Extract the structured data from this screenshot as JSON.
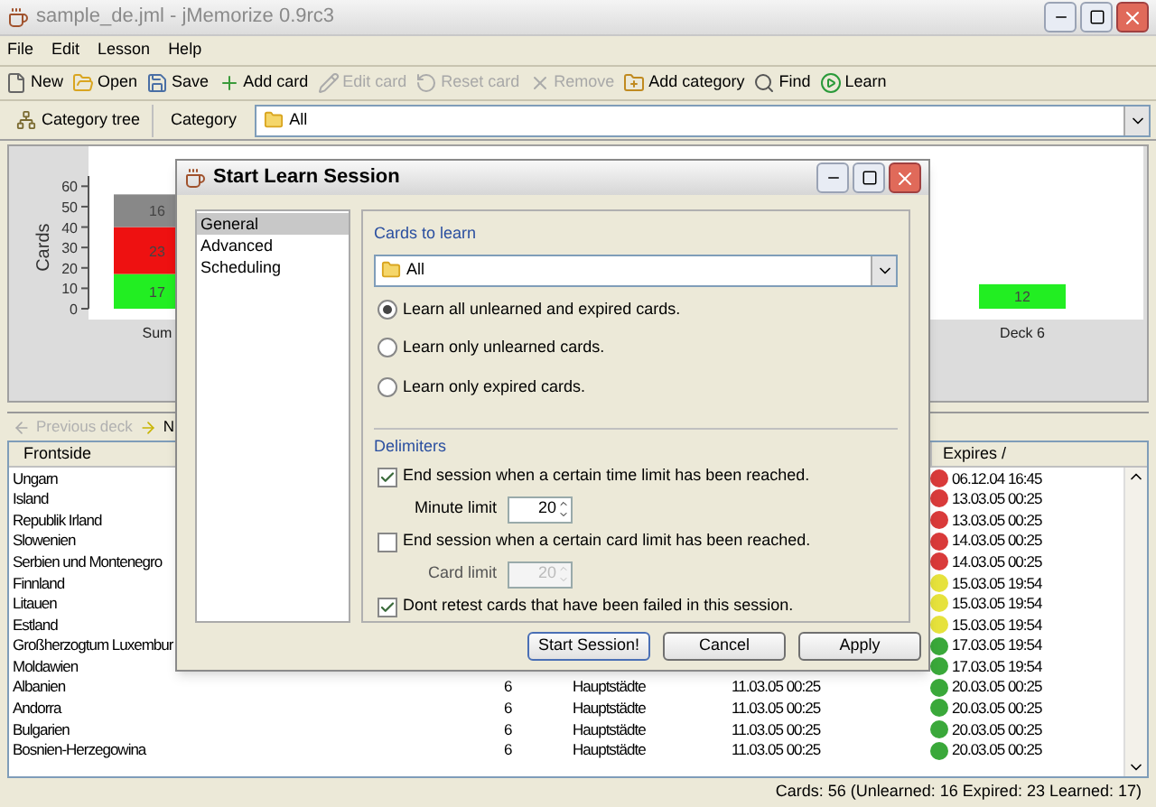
{
  "window": {
    "title": "sample_de.jml - jMemorize 0.9rc3"
  },
  "menu": [
    "File",
    "Edit",
    "Lesson",
    "Help"
  ],
  "toolbar": [
    {
      "label": "New",
      "disabled": false
    },
    {
      "label": "Open",
      "disabled": false
    },
    {
      "label": "Save",
      "disabled": false
    },
    {
      "label": "Add card",
      "disabled": false
    },
    {
      "label": "Edit card",
      "disabled": true
    },
    {
      "label": "Reset card",
      "disabled": true
    },
    {
      "label": "Remove",
      "disabled": true
    },
    {
      "label": "Add category",
      "disabled": false
    },
    {
      "label": "Find",
      "disabled": false
    },
    {
      "label": "Learn",
      "disabled": false
    }
  ],
  "category_bar": {
    "tree_button": "Category tree",
    "label": "Category",
    "value": "All"
  },
  "chart": {
    "chart_data": {
      "type": "bar",
      "ylabel": "Cards",
      "categories": [
        "Sum",
        "Deck 6"
      ],
      "stacked": true,
      "yticks": [
        0,
        10,
        20,
        30,
        40,
        50,
        60
      ],
      "ylim": [
        0,
        65
      ],
      "data_labels": true,
      "series": [
        {
          "color": "#22ee22",
          "values": [
            17,
            12
          ]
        },
        {
          "color": "#ee1111",
          "values": [
            23,
            null
          ]
        },
        {
          "color": "#888888",
          "values": [
            16,
            null
          ]
        }
      ]
    }
  },
  "deck_nav": [
    {
      "label": "Previous deck",
      "disabled": true
    },
    {
      "label": "N",
      "disabled": false
    }
  ],
  "table": {
    "columns": [
      "Frontside",
      "Expires /"
    ],
    "rows": [
      {
        "frontside": "Ungarn",
        "expires": "06.12.04 16:45",
        "color": "#d93a3a"
      },
      {
        "frontside": "Island",
        "expires": "13.03.05 00:25",
        "color": "#d93a3a"
      },
      {
        "frontside": "Republik Irland",
        "expires": "13.03.05 00:25",
        "color": "#d93a3a"
      },
      {
        "frontside": "Slowenien",
        "expires": "14.03.05 00:25",
        "color": "#d93a3a"
      },
      {
        "frontside": "Serbien und Montenegro",
        "expires": "14.03.05 00:25",
        "color": "#d93a3a"
      },
      {
        "frontside": "Finnland",
        "expires": "15.03.05 19:54",
        "color": "#e6e23c"
      },
      {
        "frontside": "Litauen",
        "expires": "15.03.05 19:54",
        "color": "#e6e23c"
      },
      {
        "frontside": "Estland",
        "expires": "15.03.05 19:54",
        "color": "#e6e23c"
      },
      {
        "frontside": "Großherzogtum Luxembur",
        "expires": "17.03.05 19:54",
        "color": "#3aa83a"
      },
      {
        "frontside": "Moldawien",
        "expires": "17.03.05 19:54",
        "color": "#3aa83a"
      },
      {
        "frontside": "Albanien",
        "deck": "6",
        "category": "Hauptstädte",
        "date": "11.03.05 00:25",
        "expires": "20.03.05 00:25",
        "color": "#3aa83a"
      },
      {
        "frontside": "Andorra",
        "deck": "6",
        "category": "Hauptstädte",
        "date": "11.03.05 00:25",
        "expires": "20.03.05 00:25",
        "color": "#3aa83a"
      },
      {
        "frontside": "Bulgarien",
        "deck": "6",
        "category": "Hauptstädte",
        "date": "11.03.05 00:25",
        "expires": "20.03.05 00:25",
        "color": "#3aa83a"
      },
      {
        "frontside": "Bosnien-Herzegowina",
        "deck": "6",
        "category": "Hauptstädte",
        "date": "11.03.05 00:25",
        "expires": "20.03.05 00:25",
        "color": "#3aa83a"
      }
    ]
  },
  "status_bar": "Cards: 56 (Unlearned: 16  Expired: 23  Learned: 17)",
  "dialog": {
    "title": "Start Learn Session",
    "pages": [
      {
        "label": "General",
        "selected": true
      },
      {
        "label": "Advanced",
        "selected": false
      },
      {
        "label": "Scheduling",
        "selected": false
      }
    ],
    "cards_group": "Cards to learn",
    "category": "All",
    "radios": [
      {
        "label": "Learn all unlearned and expired cards.",
        "selected": true
      },
      {
        "label": "Learn only unlearned cards.",
        "selected": false
      },
      {
        "label": "Learn only expired cards.",
        "selected": false
      }
    ],
    "delimiters_group": "Delimiters",
    "options": [
      {
        "kind": "check",
        "label": "End session when a certain time limit has been reached.",
        "checked": true
      },
      {
        "kind": "spin",
        "label": "Minute limit",
        "value": "20",
        "disabled": false
      },
      {
        "kind": "check",
        "label": "End session when a certain card limit has been reached.",
        "checked": false
      },
      {
        "kind": "spin",
        "label": "Card limit",
        "value": "20",
        "disabled": true
      },
      {
        "kind": "check",
        "label": "Dont retest cards that have been failed in this session.",
        "checked": true
      }
    ],
    "buttons": [
      "Start Session!",
      "Cancel",
      "Apply"
    ]
  }
}
